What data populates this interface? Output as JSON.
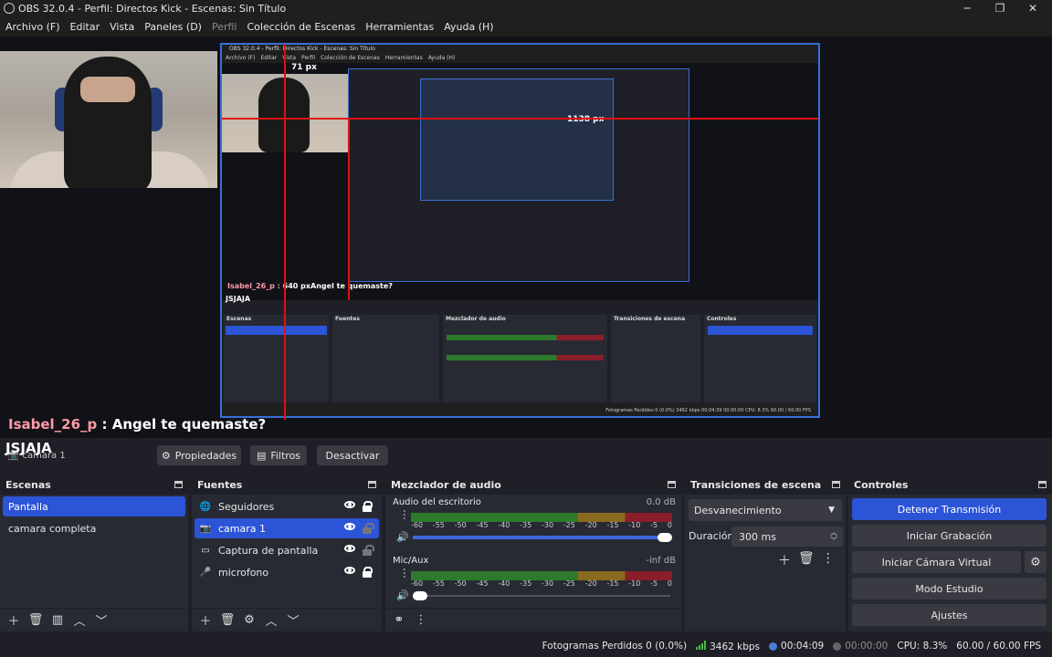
{
  "window": {
    "title": "OBS 32.0.4 - Perfil: Directos Kick - Escenas: Sin Título",
    "controls": [
      "─",
      "❐",
      "✕"
    ]
  },
  "menu": [
    {
      "label": "Archivo (F)",
      "disabled": false
    },
    {
      "label": "Editar",
      "disabled": false
    },
    {
      "label": "Vista",
      "disabled": false
    },
    {
      "label": "Paneles (D)",
      "disabled": false
    },
    {
      "label": "Perfil",
      "disabled": true
    },
    {
      "label": "Colección de Escenas",
      "disabled": false
    },
    {
      "label": "Herramientas",
      "disabled": false
    },
    {
      "label": "Ayuda (H)",
      "disabled": false
    }
  ],
  "preview": {
    "nested_title": "OBS 32.0.4 - Perfil: Directos Kick - Escenas: Sin Título",
    "nested_menu": [
      "Archivo (F)",
      "Editar",
      "Vista",
      "Perfil",
      "Colección de Escenas",
      "Herramientas",
      "Ayuda (H)"
    ],
    "measure_top": "71 px",
    "measure_right": "1138 px",
    "measure_small": "640 px",
    "nested_chat": "Isabel_26_p : ",
    "nested_chat_msg": "Angel te quemaste?",
    "nested_jsjaja": "JSJAJA",
    "nested_docks": [
      "Escenas",
      "Fuentes",
      "Mezclador de audio",
      "Transiciones de escena",
      "Controles"
    ],
    "nested_status": "Fotogramas Perdidos 0 (0.0%)   3462 kbps   00:04:39   00:00:00   CPU: 8.3%   60.00 / 60.00 FPS"
  },
  "chat": {
    "user": "Isabel_26_p",
    "separator": " : ",
    "message": "Angel te quemaste?",
    "overlay": "JSJAJA"
  },
  "toolbar": {
    "selected_source": "camara 1",
    "properties": "Propiedades",
    "filters": "Filtros",
    "deactivate": "Desactivar"
  },
  "scenes": {
    "title": "Escenas",
    "items": [
      {
        "label": "Pantalla",
        "active": true
      },
      {
        "label": "camara completa",
        "active": false
      }
    ]
  },
  "sources": {
    "title": "Fuentes",
    "items": [
      {
        "label": "Seguidores",
        "icon": "globe-icon",
        "active": false,
        "locked": true
      },
      {
        "label": "camara 1",
        "icon": "camera-icon",
        "active": true,
        "locked": false
      },
      {
        "label": "Captura de pantalla",
        "icon": "monitor-icon",
        "active": false,
        "locked": false
      },
      {
        "label": "microfono",
        "icon": "microphone-icon",
        "active": false,
        "locked": true
      }
    ]
  },
  "mixer": {
    "title": "Mezclador de audio",
    "channels": [
      {
        "name": "Audio del escritorio",
        "db": "0.0 dB",
        "volume": 1.0
      },
      {
        "name": "Mic/Aux",
        "db": "-inf dB",
        "volume": 0.0
      }
    ],
    "ticks": [
      "-60",
      "-55",
      "-50",
      "-45",
      "-40",
      "-35",
      "-30",
      "-25",
      "-20",
      "-15",
      "-10",
      "-5",
      "0"
    ]
  },
  "transitions": {
    "title": "Transiciones de escena",
    "selected": "Desvanecimiento",
    "duration_label": "Duración",
    "duration_value": "300 ms"
  },
  "controls": {
    "title": "Controles",
    "stop_stream": "Detener Transmisión",
    "start_recording": "Iniciar Grabación",
    "start_virtual_cam": "Iniciar Cámara Virtual",
    "studio_mode": "Modo Estudio",
    "settings": "Ajustes"
  },
  "status": {
    "dropped_frames": "Fotogramas Perdidos 0 (0.0%)",
    "bitrate": "3462 kbps",
    "stream_time": "00:04:09",
    "record_time": "00:00:00",
    "cpu": "CPU: 8.3%",
    "fps": "60.00 / 60.00 FPS"
  },
  "colors": {
    "accent": "#2c54d6",
    "background": "#1e1f27",
    "panel": "#272a33",
    "meter_green": "#2d7a2d",
    "meter_yellow": "#8a6a1e",
    "meter_red": "#8a1e2a",
    "chat_user": "#ff9aa8"
  }
}
